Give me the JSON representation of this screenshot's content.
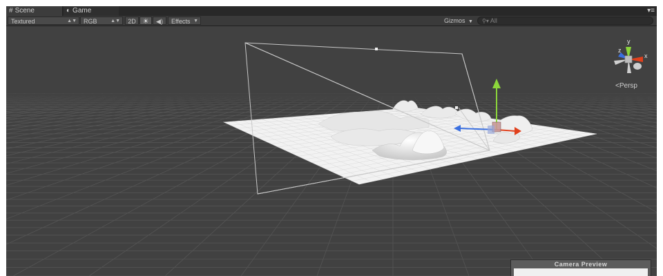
{
  "tabs": [
    {
      "label": "Scene",
      "icon": "grid-icon",
      "active": true
    },
    {
      "label": "Game",
      "icon": "pacman-icon",
      "active": false
    }
  ],
  "toolbar": {
    "render_mode": "Textured",
    "color_mode": "RGB",
    "mode_2d": "2D",
    "lighting_icon": "sun-icon",
    "audio_icon": "speaker-icon",
    "effects_label": "Effects",
    "gizmos_label": "Gizmos",
    "search_placeholder": "All",
    "search_icon": "search-icon"
  },
  "viewport": {
    "background_color": "#414141",
    "grid_color": "#5a5a5a",
    "terrain_color": "#f2f2f2",
    "gizmo_axes": {
      "x": "x",
      "y": "y",
      "z": "z"
    },
    "gizmo_colors": {
      "x": "#e0401c",
      "y": "#8cd63b",
      "z": "#3a6fe0"
    },
    "projection_label": "Persp"
  },
  "camera_preview": {
    "title": "Camera Preview"
  }
}
